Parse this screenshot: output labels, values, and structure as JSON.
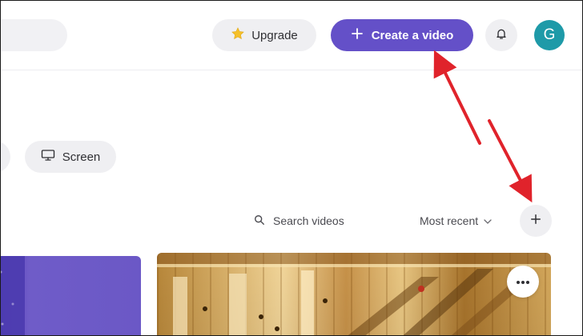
{
  "header": {
    "upgrade_label": "Upgrade",
    "create_label": "Create a video",
    "avatar_initial": "G"
  },
  "filters": {
    "screen_label": "Screen"
  },
  "toolbar": {
    "search_placeholder": "Search videos",
    "sort_label": "Most recent"
  },
  "colors": {
    "accent": "#6450c8",
    "avatar": "#1e9aa8",
    "annotation": "#e0232b",
    "chip_bg": "#efeff2"
  },
  "icons": {
    "upgrade": "star-icon",
    "create": "plus-icon",
    "bell": "bell-icon",
    "screen": "monitor-icon",
    "search": "search-icon",
    "sort": "chevron-down-icon",
    "add": "plus-icon",
    "more": "more-horizontal-icon"
  }
}
